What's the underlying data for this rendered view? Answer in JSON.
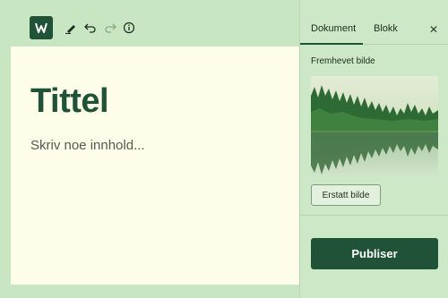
{
  "colors": {
    "accent": "#1f5236",
    "background": "#c8e6c2",
    "canvas": "#fefde9",
    "sidebar": "#cde8c7"
  },
  "toolbar": {
    "logo_icon": "w-logo-icon",
    "icons": [
      "pen-icon",
      "undo-icon",
      "redo-icon",
      "info-icon"
    ]
  },
  "editor": {
    "title": "Tittel",
    "content_placeholder": "Skriv noe innhold..."
  },
  "sidebar": {
    "tabs": [
      {
        "label": "Dokument",
        "active": true
      },
      {
        "label": "Blokk",
        "active": false
      }
    ],
    "close_icon": "close-icon",
    "featured_image_label": "Fremhevet bilde",
    "replace_button": "Erstatt bilde",
    "publish_button": "Publiser"
  }
}
